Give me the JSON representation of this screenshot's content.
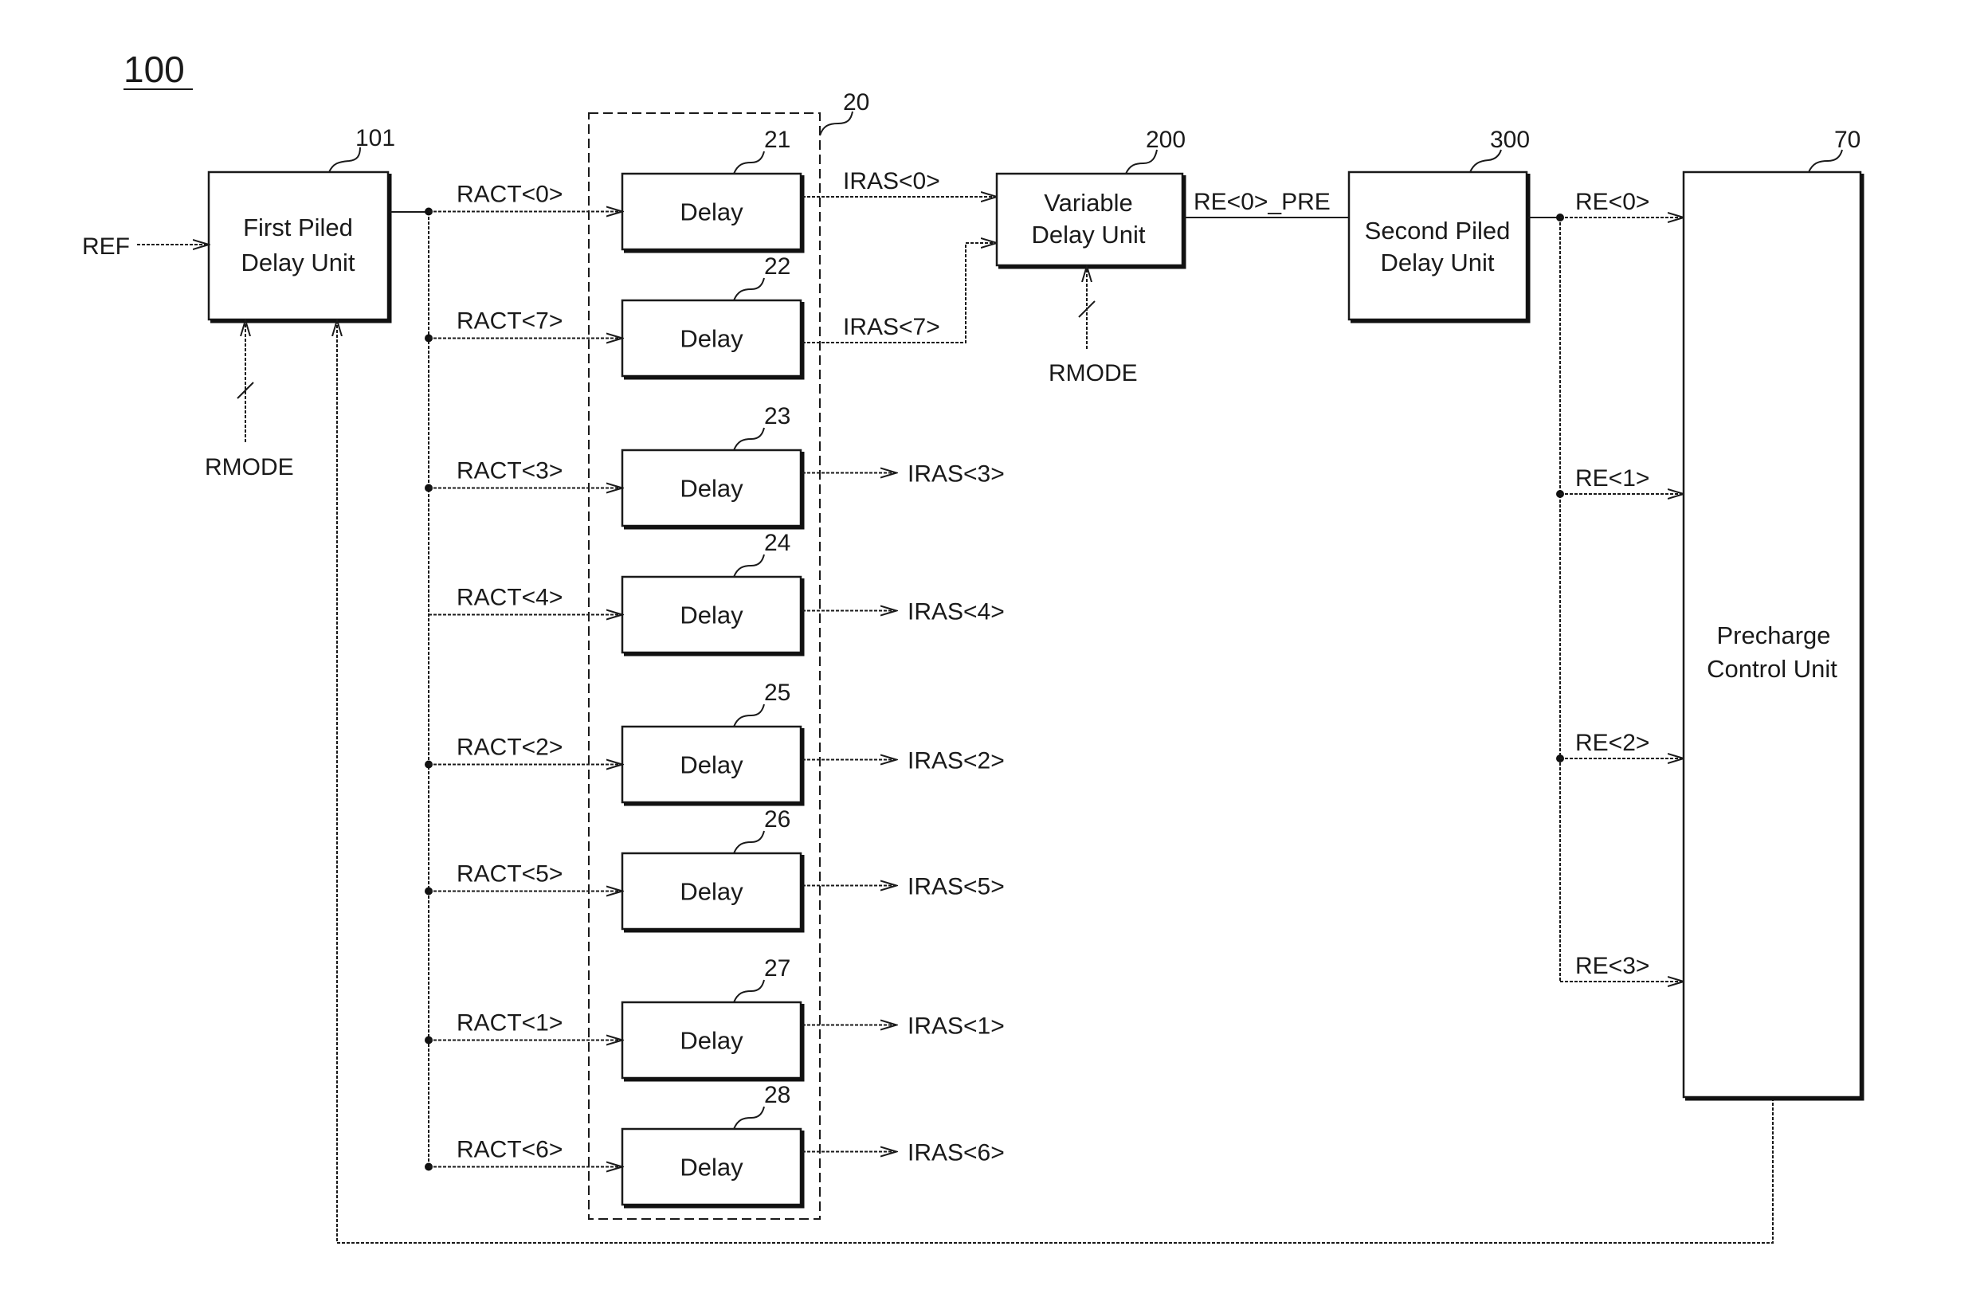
{
  "figure": {
    "number": "100",
    "colors": {
      "ink": "#1a1a1a",
      "background": "#ffffff"
    }
  },
  "blocks": {
    "first_piled": {
      "ref": "101",
      "line1": "First Piled",
      "line2": "Delay Unit"
    },
    "delay_group": {
      "ref": "20"
    },
    "variable": {
      "ref": "200",
      "line1": "Variable",
      "line2": "Delay Unit"
    },
    "second_piled": {
      "ref": "300",
      "line1": "Second Piled",
      "line2": "Delay Unit"
    },
    "precharge": {
      "ref": "70",
      "line1": "Precharge",
      "line2": "Control Unit"
    }
  },
  "delays": [
    {
      "ref": "21",
      "label": "Delay",
      "input": "RACT<0>",
      "output": "IRAS<0>"
    },
    {
      "ref": "22",
      "label": "Delay",
      "input": "RACT<7>",
      "output": "IRAS<7>"
    },
    {
      "ref": "23",
      "label": "Delay",
      "input": "RACT<3>",
      "output": "IRAS<3>"
    },
    {
      "ref": "24",
      "label": "Delay",
      "input": "RACT<4>",
      "output": "IRAS<4>"
    },
    {
      "ref": "25",
      "label": "Delay",
      "input": "RACT<2>",
      "output": "IRAS<2>"
    },
    {
      "ref": "26",
      "label": "Delay",
      "input": "RACT<5>",
      "output": "IRAS<5>"
    },
    {
      "ref": "27",
      "label": "Delay",
      "input": "RACT<1>",
      "output": "IRAS<1>"
    },
    {
      "ref": "28",
      "label": "Delay",
      "input": "RACT<6>",
      "output": "IRAS<6>"
    }
  ],
  "signals": {
    "ref_in": "REF",
    "rmode_first": "RMODE",
    "rmode_variable": "RMODE",
    "re0_pre": "RE<0>_PRE",
    "re_outputs": [
      "RE<0>",
      "RE<1>",
      "RE<2>",
      "RE<3>"
    ]
  }
}
